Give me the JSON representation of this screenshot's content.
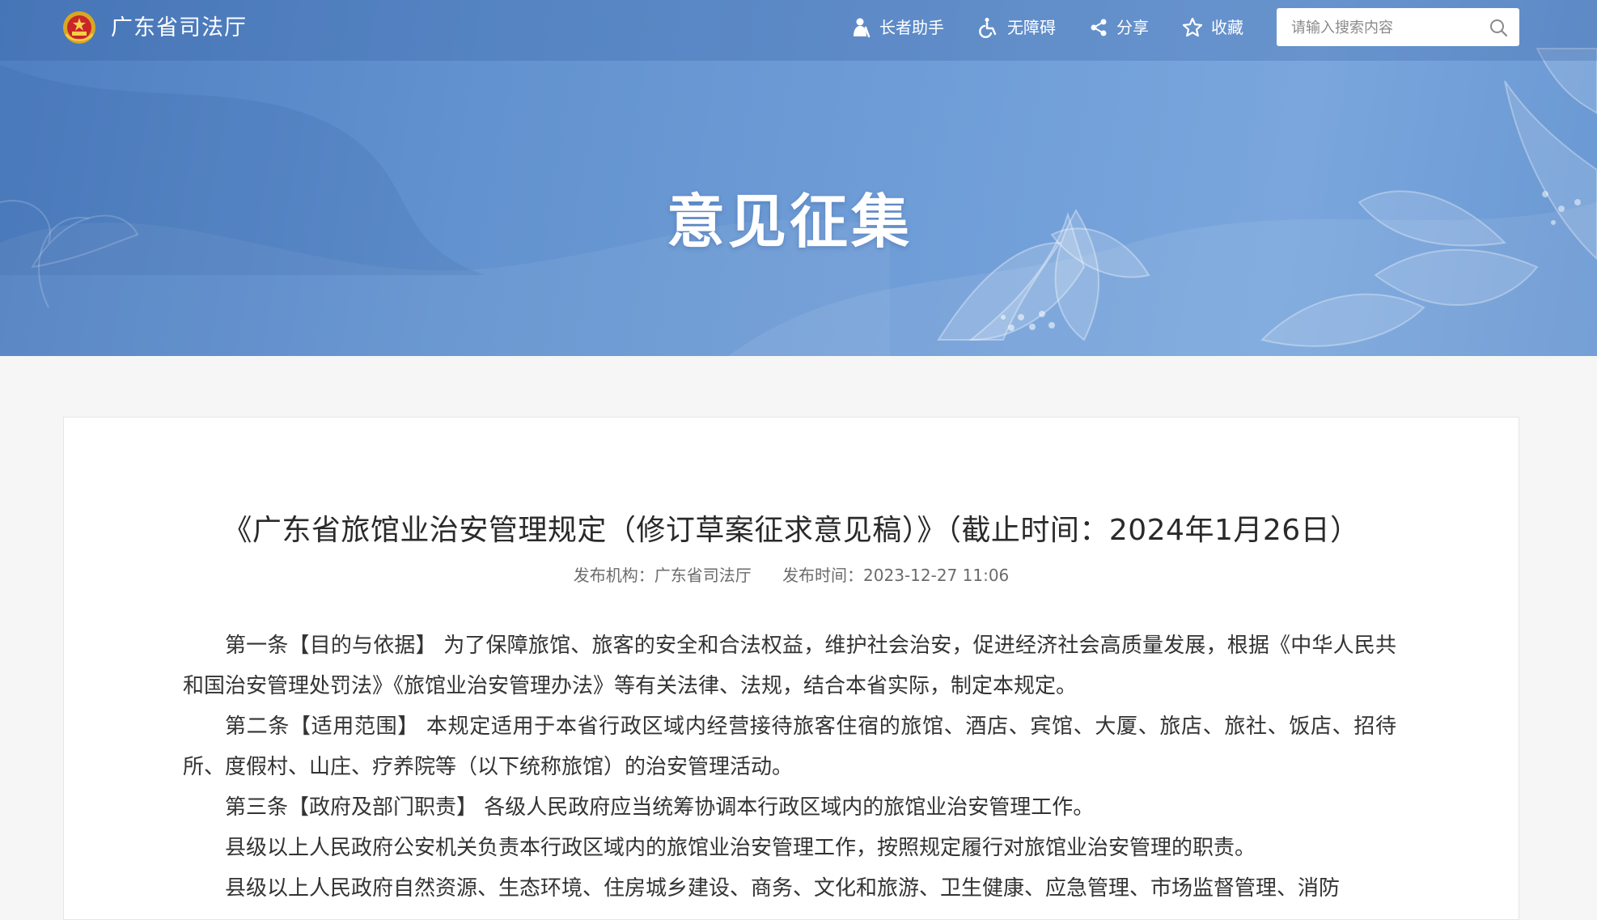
{
  "site": {
    "name": "广东省司法厅"
  },
  "toolbar": {
    "elder": "长者助手",
    "accessibility": "无障碍",
    "share": "分享",
    "favorite": "收藏"
  },
  "search": {
    "placeholder": "请输入搜索内容",
    "value": ""
  },
  "banner": {
    "title": "意见征集"
  },
  "document": {
    "title": "《广东省旅馆业治安管理规定（修订草案征求意见稿）》（截止时间：2024年1月26日）",
    "publisher": "发布机构：广东省司法厅",
    "published_at": "发布时间：2023-12-27 11:06",
    "paragraphs": [
      "第一条【目的与依据】 为了保障旅馆、旅客的安全和合法权益，维护社会治安，促进经济社会高质量发展，根据《中华人民共和国治安管理处罚法》《旅馆业治安管理办法》等有关法律、法规，结合本省实际，制定本规定。",
      "第二条【适用范围】 本规定适用于本省行政区域内经营接待旅客住宿的旅馆、酒店、宾馆、大厦、旅店、旅社、饭店、招待所、度假村、山庄、疗养院等（以下统称旅馆）的治安管理活动。",
      "第三条【政府及部门职责】 各级人民政府应当统筹协调本行政区域内的旅馆业治安管理工作。",
      "县级以上人民政府公安机关负责本行政区域内的旅馆业治安管理工作，按照规定履行对旅馆业治安管理的职责。",
      "县级以上人民政府自然资源、生态环境、住房城乡建设、商务、文化和旅游、卫生健康、应急管理、市场监督管理、消防"
    ]
  },
  "colors": {
    "banner_start": "#4f7fc0",
    "banner_end": "#7aa6dd",
    "page_bg": "#f6f6f6",
    "text": "#333333",
    "meta": "#6b6b6b"
  },
  "icons": [
    "emblem-icon",
    "elder-icon",
    "wheelchair-icon",
    "share-icon",
    "star-icon",
    "search-icon"
  ]
}
